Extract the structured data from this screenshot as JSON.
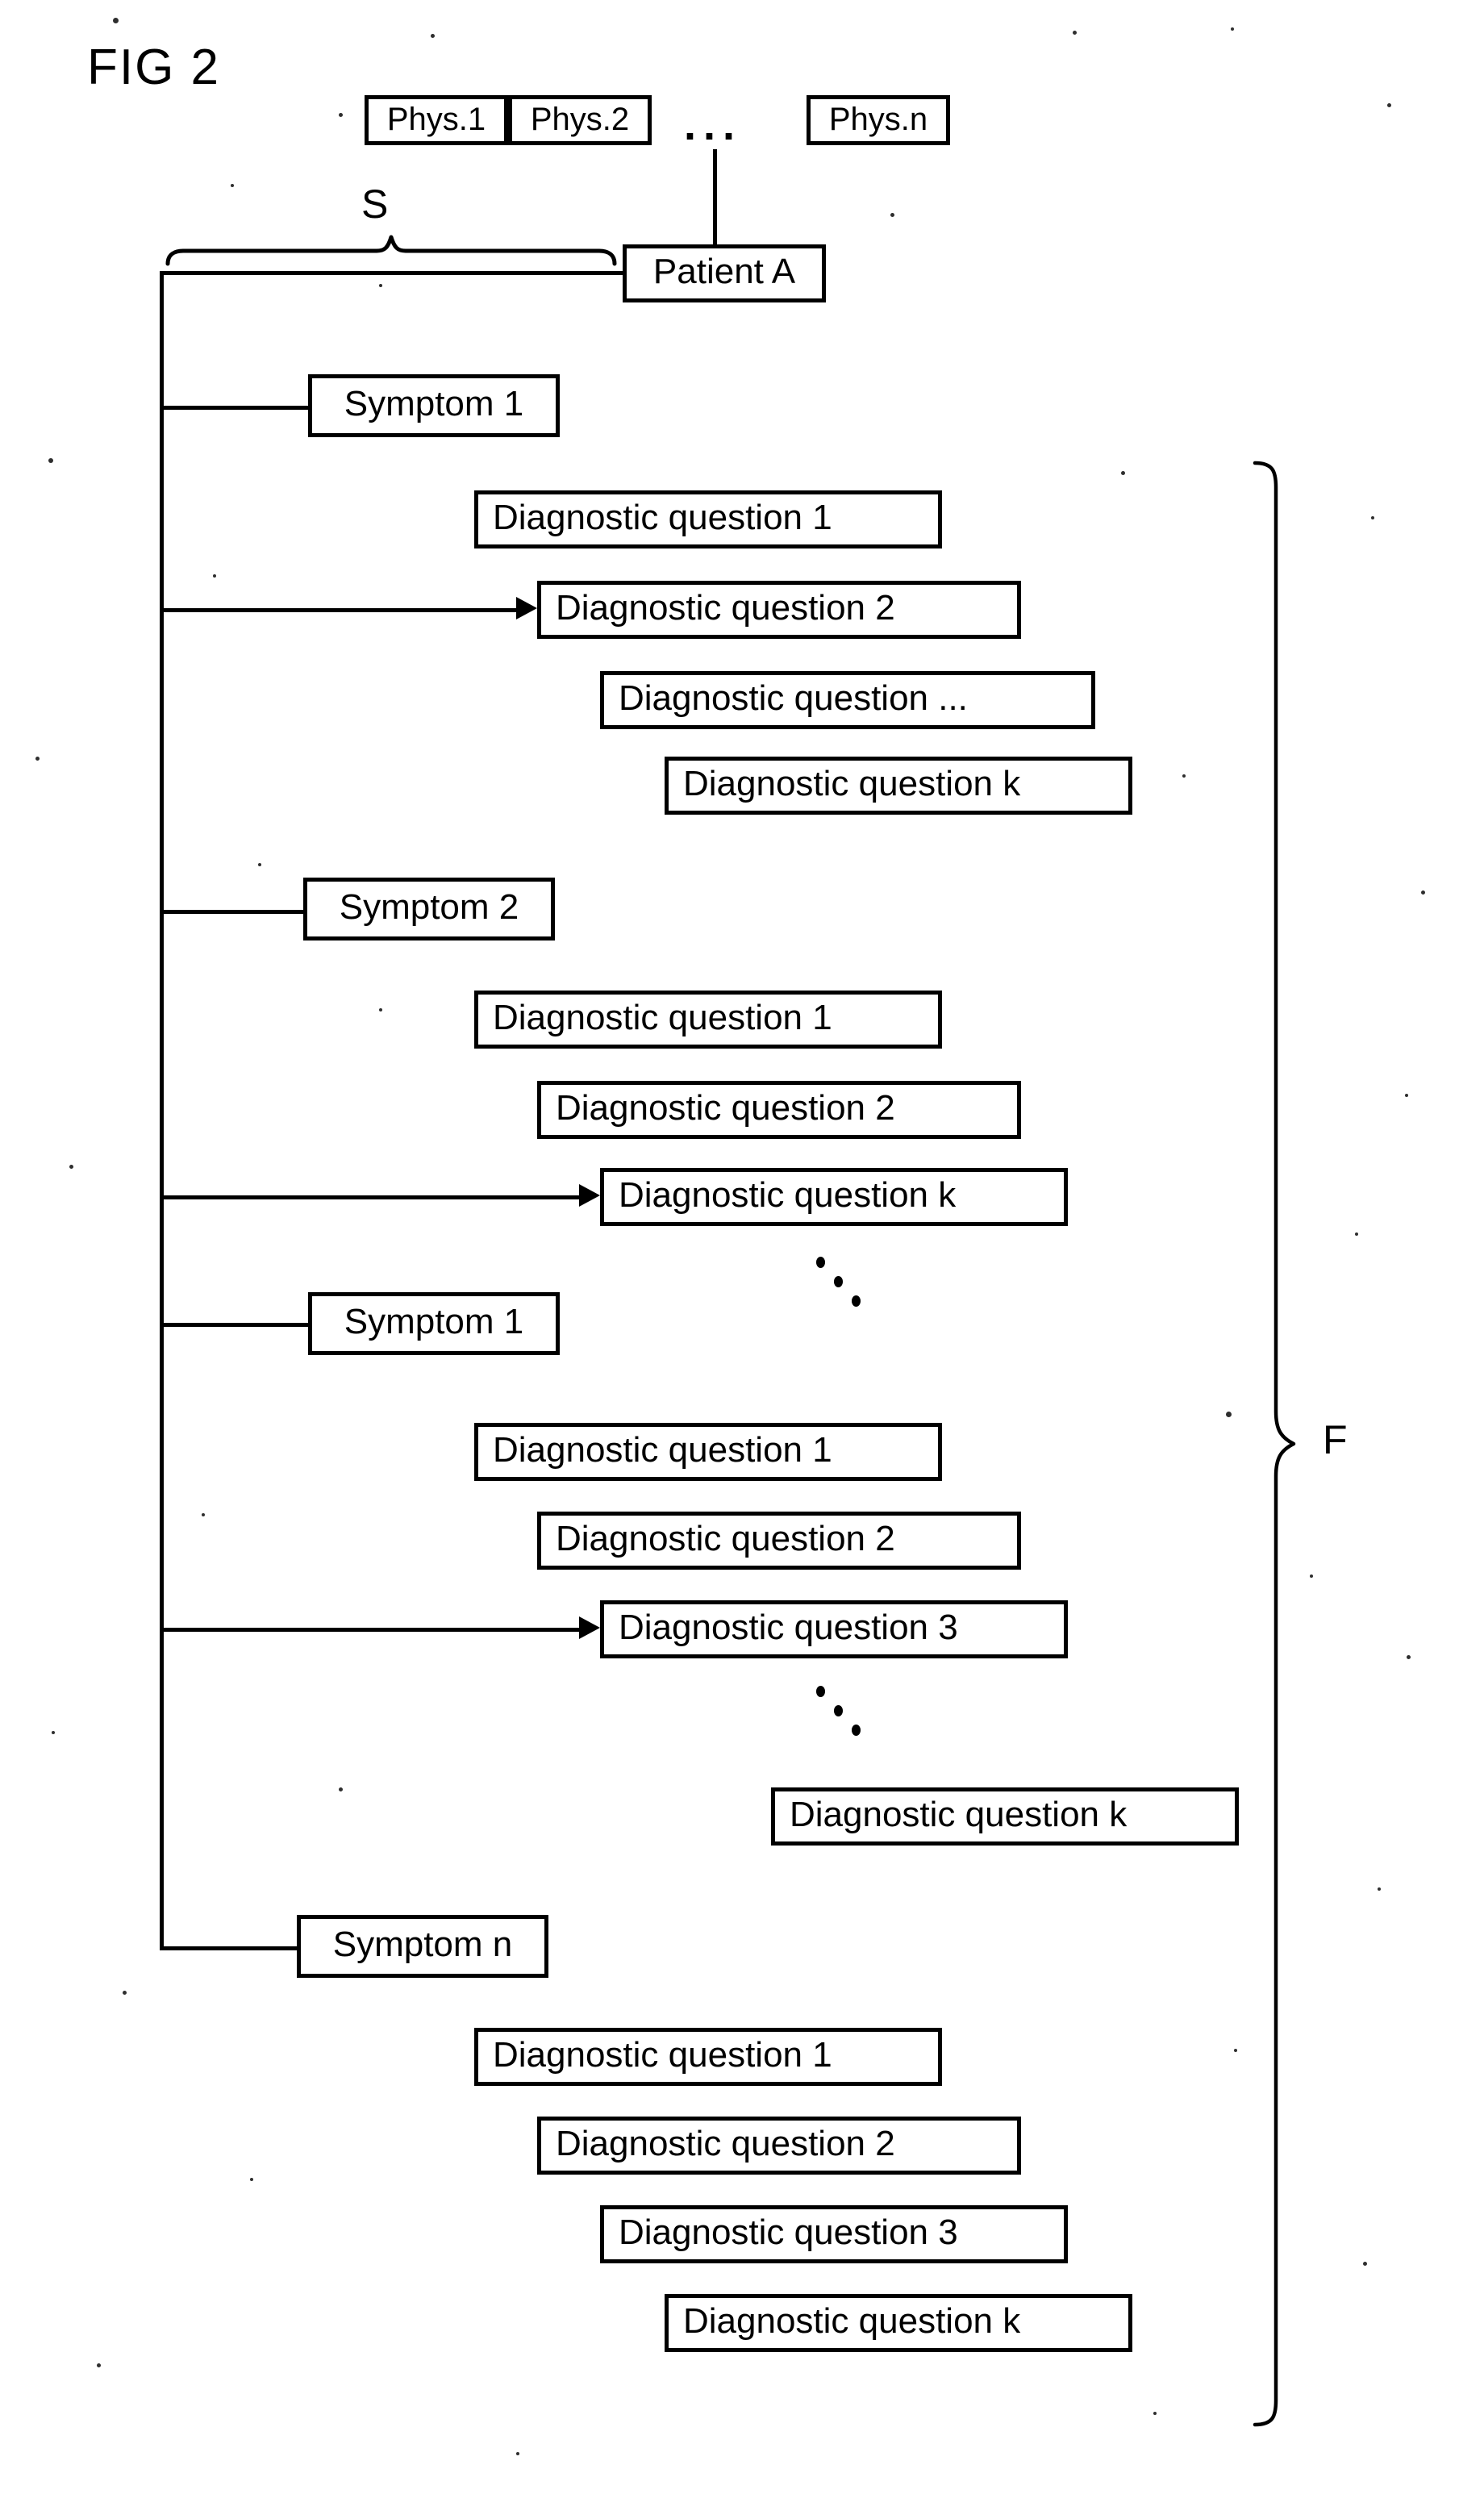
{
  "figure": {
    "title": "FIG 2",
    "ellipsis_horizontal": "...",
    "labels": {
      "sources_brace": "S",
      "forms_brace": "F"
    }
  },
  "physicians": [
    {
      "label": "Phys.1"
    },
    {
      "label": "Phys.2"
    },
    {
      "label": "Phys.n"
    }
  ],
  "patient": {
    "label": "Patient A"
  },
  "symptom_groups": [
    {
      "symptom": {
        "label": "Symptom 1"
      },
      "questions": [
        {
          "label": "Diagnostic question 1",
          "has_arrow": false
        },
        {
          "label": "Diagnostic question 2",
          "has_arrow": true
        },
        {
          "label": "Diagnostic question ...",
          "has_arrow": false
        },
        {
          "label": "Diagnostic question k",
          "has_arrow": false
        }
      ]
    },
    {
      "symptom": {
        "label": "Symptom 2"
      },
      "questions": [
        {
          "label": "Diagnostic question 1",
          "has_arrow": false
        },
        {
          "label": "Diagnostic question 2",
          "has_arrow": false
        },
        {
          "label": "Diagnostic question k",
          "has_arrow": true
        }
      ]
    },
    {
      "symptom": {
        "label": "Symptom 1"
      },
      "questions": [
        {
          "label": "Diagnostic question 1",
          "has_arrow": false
        },
        {
          "label": "Diagnostic question 2",
          "has_arrow": false
        },
        {
          "label": "Diagnostic question 3",
          "has_arrow": true
        },
        {
          "label": "Diagnostic question k",
          "has_arrow": false
        }
      ]
    },
    {
      "symptom": {
        "label": "Symptom n"
      },
      "questions": [
        {
          "label": "Diagnostic question 1",
          "has_arrow": false
        },
        {
          "label": "Diagnostic question 2",
          "has_arrow": false
        },
        {
          "label": "Diagnostic question 3",
          "has_arrow": false
        },
        {
          "label": "Diagnostic question k",
          "has_arrow": false
        }
      ]
    }
  ],
  "colors": {
    "ink": "#000000",
    "paper": "#ffffff"
  }
}
